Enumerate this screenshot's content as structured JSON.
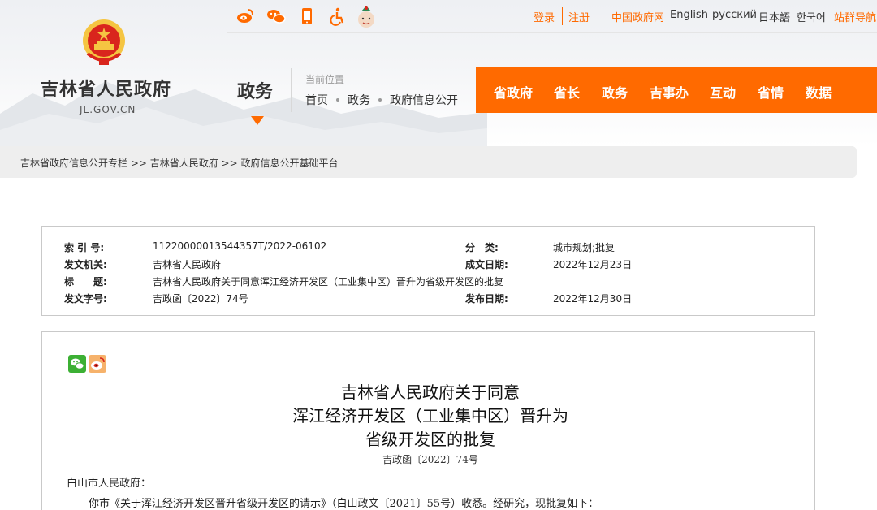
{
  "header": {
    "site_title": "吉林省人民政府",
    "site_domain": "JL.GOV.CN",
    "section_title": "政务",
    "location_label": "当前位置",
    "location_crumbs": [
      "首页",
      "政务",
      "政府信息公开"
    ]
  },
  "top_icons": [
    "weibo-icon",
    "wechat-icon",
    "mobile-icon",
    "accessibility-icon",
    "mascot-icon"
  ],
  "top_links": {
    "login": "登录",
    "register": "注册",
    "gov_cn": "中国政府网",
    "english": "English",
    "russian": "русский",
    "japanese": "日本語",
    "korean": "한국어",
    "site_nav": "站群导航"
  },
  "main_nav": [
    "省政府",
    "省长",
    "政务",
    "吉事办",
    "互动",
    "省情",
    "数据"
  ],
  "breadcrumb": "吉林省政府信息公开专栏 >> 吉林省人民政府 >> 政府信息公开基础平台",
  "info": {
    "index_label": "索 引 号:",
    "index_value": "11220000013544357T/2022-06102",
    "category_label": "分　类:",
    "category_value": "城市规划;批复",
    "issuer_label": "发文机关:",
    "issuer_value": "吉林省人民政府",
    "date_written_label": "成文日期:",
    "date_written_value": "2022年12月23日",
    "title_label": "标　　题:",
    "title_value": "吉林省人民政府关于同意浑江经济开发区（工业集中区）晋升为省级开发区的批复",
    "doc_number_label": "发文字号:",
    "doc_number_value": "吉政函〔2022〕74号",
    "publish_date_label": "发布日期:",
    "publish_date_value": "2022年12月30日"
  },
  "document": {
    "title_lines": [
      "吉林省人民政府关于同意",
      "浑江经济开发区（工业集中区）晋升为",
      "省级开发区的批复"
    ],
    "doc_number": "吉政函〔2022〕74号",
    "addressee": "白山市人民政府：",
    "body_first_line": "你市《关于浑江经济开发区晋升省级开发区的请示》（白山政文〔2021〕55号）收悉。经研究，现批复如下："
  },
  "colors": {
    "accent": "#ff6a00",
    "crumb_bg": "#eeeeee",
    "border": "#c9c9c9"
  }
}
